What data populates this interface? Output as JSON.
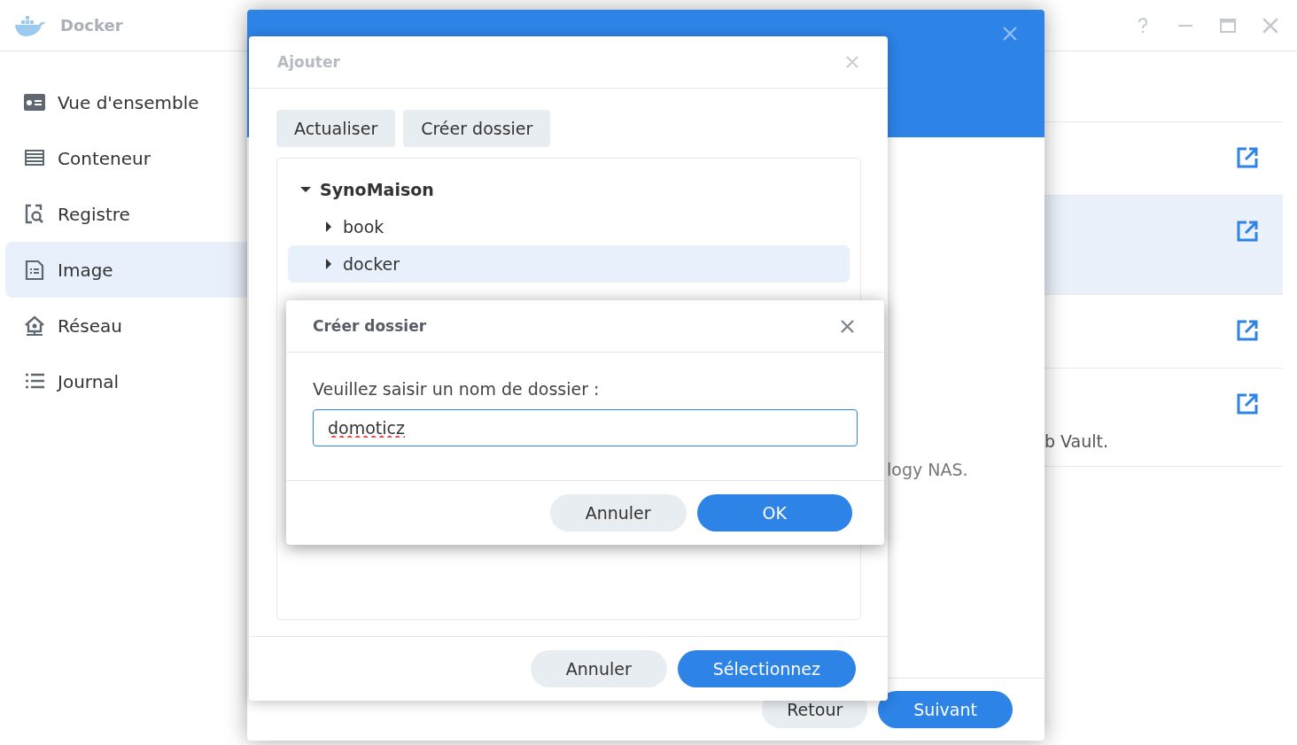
{
  "app": {
    "title": "Docker"
  },
  "sidebar": {
    "items": [
      {
        "label": "Vue d'ensemble",
        "selected": false
      },
      {
        "label": "Conteneur",
        "selected": false
      },
      {
        "label": "Registre",
        "selected": false
      },
      {
        "label": "Image",
        "selected": true
      },
      {
        "label": "Réseau",
        "selected": false
      },
      {
        "label": "Journal",
        "selected": false
      }
    ]
  },
  "list": {
    "rows": [
      {
        "selected": false
      },
      {
        "selected": true
      },
      {
        "selected": false
      },
      {
        "selected": false,
        "text": "b Vault."
      }
    ]
  },
  "wizard": {
    "body_text": "logy NAS.",
    "buttons": [
      {
        "label": "Retour",
        "kind": "secondary"
      },
      {
        "label": "Suivant",
        "kind": "primary"
      }
    ]
  },
  "picker": {
    "title": "Ajouter",
    "toolbar": [
      "Actualiser",
      "Créer dossier"
    ],
    "tree": [
      {
        "label": "SynoMaison",
        "expanded": true,
        "selected": false,
        "children": [
          {
            "label": "book",
            "expanded": false,
            "selected": false
          },
          {
            "label": "docker",
            "expanded": false,
            "selected": true
          }
        ]
      }
    ],
    "buttons": [
      {
        "label": "Annuler",
        "kind": "secondary"
      },
      {
        "label": "Sélectionnez",
        "kind": "primary"
      }
    ]
  },
  "prompt": {
    "title": "Créer dossier",
    "label": "Veuillez saisir un nom de dossier :",
    "value": "domoticz",
    "buttons": [
      {
        "label": "Annuler",
        "kind": "secondary"
      },
      {
        "label": "OK",
        "kind": "primary"
      }
    ]
  }
}
